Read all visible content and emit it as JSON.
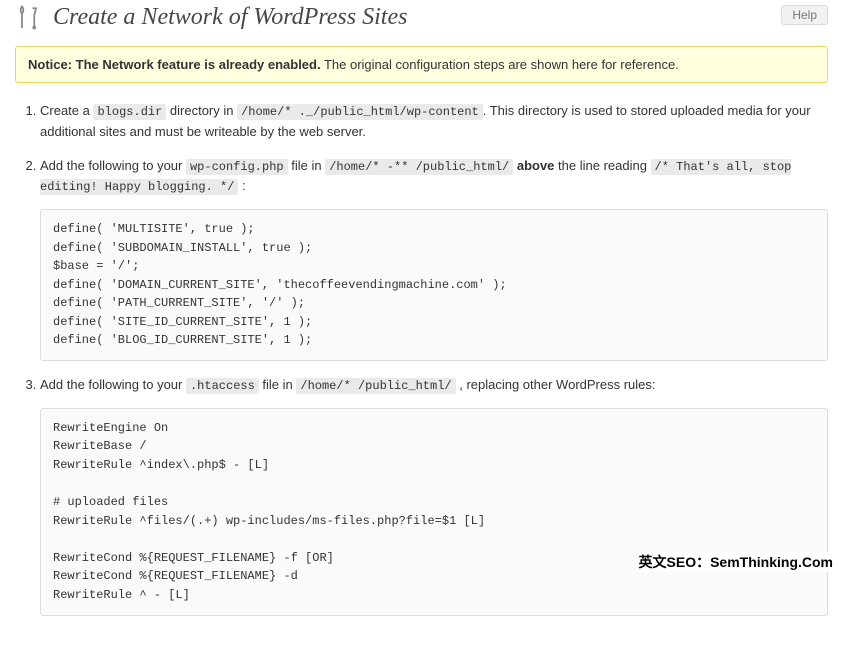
{
  "header": {
    "title": "Create a Network of WordPress Sites",
    "help_label": "Help"
  },
  "notice": {
    "strong": "Notice: The Network feature is already enabled.",
    "rest": " The original configuration steps are shown here for reference."
  },
  "steps": {
    "s1": {
      "t1": "Create a ",
      "code1": "blogs.dir",
      "t2": " directory in ",
      "code2": "/home/*      ._/public_html/wp-content",
      "t3": ". This directory is used to stored uploaded media for your additional sites and must be writeable by the web server."
    },
    "s2": {
      "t1": "Add the following to your ",
      "code1": "wp-config.php",
      "t2": " file in ",
      "code2": "/home/*   -** /public_html/",
      "t3": " ",
      "above": "above",
      "t4": " the line reading ",
      "code3": "/* That's all, stop editing! Happy blogging. */",
      "t5": " :",
      "block": "define( 'MULTISITE', true );\ndefine( 'SUBDOMAIN_INSTALL', true );\n$base = '/';\ndefine( 'DOMAIN_CURRENT_SITE', 'thecoffeevendingmachine.com' );\ndefine( 'PATH_CURRENT_SITE', '/' );\ndefine( 'SITE_ID_CURRENT_SITE', 1 );\ndefine( 'BLOG_ID_CURRENT_SITE', 1 );"
    },
    "s3": {
      "t1": "Add the following to your ",
      "code1": ".htaccess",
      "t2": " file in ",
      "code2": "/home/*      /public_html/",
      "t3": " , replacing other WordPress rules:",
      "block": "RewriteEngine On\nRewriteBase /\nRewriteRule ^index\\.php$ - [L]\n\n# uploaded files\nRewriteRule ^files/(.+) wp-includes/ms-files.php?file=$1 [L]\n\nRewriteCond %{REQUEST_FILENAME} -f [OR]\nRewriteCond %{REQUEST_FILENAME} -d\nRewriteRule ^ - [L]\n"
    }
  },
  "watermark": "英文SEO：SemThinking.Com"
}
